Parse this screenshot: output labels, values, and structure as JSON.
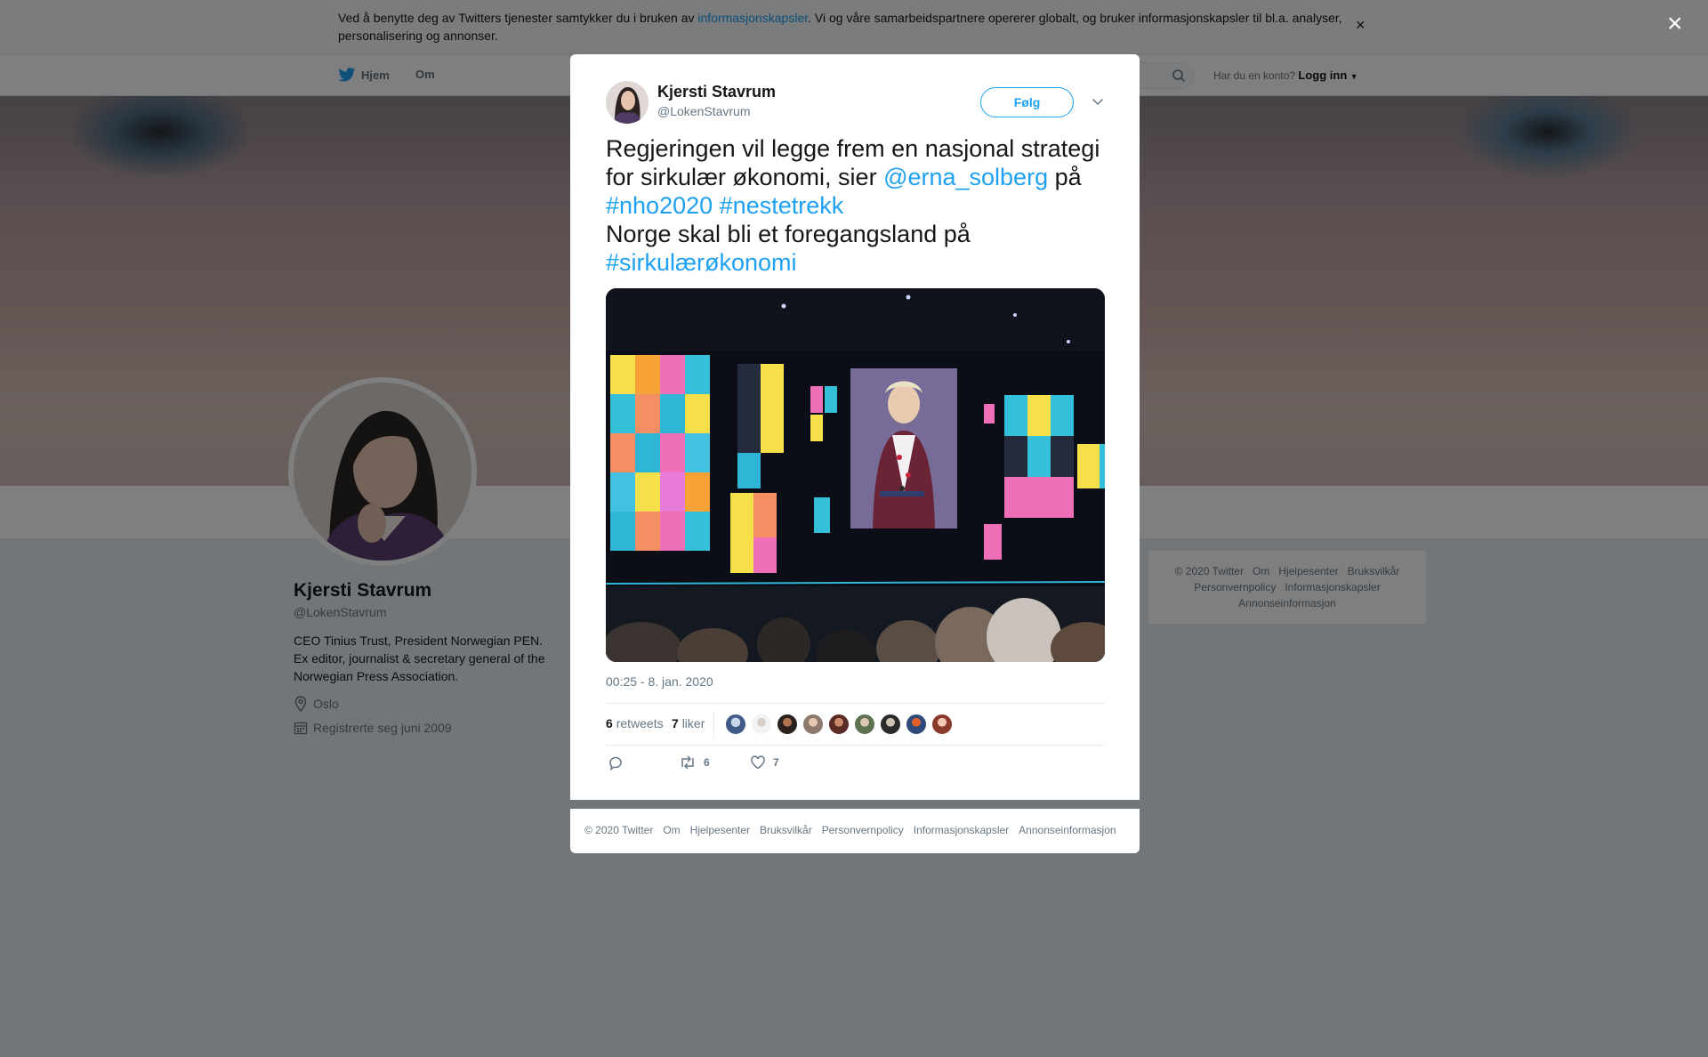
{
  "cookie_banner": {
    "text_before": "Ved å benytte deg av Twitters tjenester samtykker du i bruken av ",
    "link": "informasjonskapsler",
    "text_after": ". Vi og våre samarbeidspartnere opererer globalt, og bruker informasjonskapsler til bl.a. analyser, personalisering og annonser.",
    "close": "×"
  },
  "nav": {
    "home": "Hjem",
    "about": "Om",
    "login_prompt": "Har du en konto?",
    "login_link": "Logg inn"
  },
  "profile": {
    "name": "Kjersti Stavrum",
    "handle": "@LokenStavrum",
    "bio": "CEO Tinius Trust, President Norwegian PEN. Ex editor, journalist & secretary general of the Norwegian Press Association.",
    "location": "Oslo",
    "joined": "Registrerte seg juni 2009"
  },
  "side_footer": {
    "row1": [
      "© 2020 Twitter",
      "Om",
      "Hjelpesenter",
      "Bruksvilkår"
    ],
    "row2": [
      "Personvernpolicy",
      "Informasjonskapsler"
    ],
    "row3": [
      "Annonseinformasjon"
    ]
  },
  "overlay_close": "×",
  "tweet": {
    "author_name": "Kjersti Stavrum",
    "author_handle": "@LokenStavrum",
    "follow_label": "Følg",
    "text": {
      "part1": "Regjeringen vil legge frem en nasjonal strategi for sirkulær økonomi, sier ",
      "mention": "@erna_solberg",
      "part2": " på ",
      "hashtag1": "#nho2020",
      "hashtag2": "#nestetrekk",
      "part3": "Norge skal bli et foregangsland på ",
      "hashtag3": "#sirkulærøkonomi"
    },
    "timestamp": "00:25 - 8. jan. 2020",
    "retweets_count": "6",
    "retweets_label": "retweets",
    "likes_count": "7",
    "likes_label": "liker",
    "action_retweets": "6",
    "action_likes": "7"
  },
  "colors": {
    "accent": "#1da1f2",
    "text": "#14171a",
    "muted": "#657786"
  },
  "modal_footer": [
    "© 2020 Twitter",
    "Om",
    "Hjelpesenter",
    "Bruksvilkår",
    "Personvernpolicy",
    "Informasjonskapsler",
    "Annonseinformasjon"
  ]
}
